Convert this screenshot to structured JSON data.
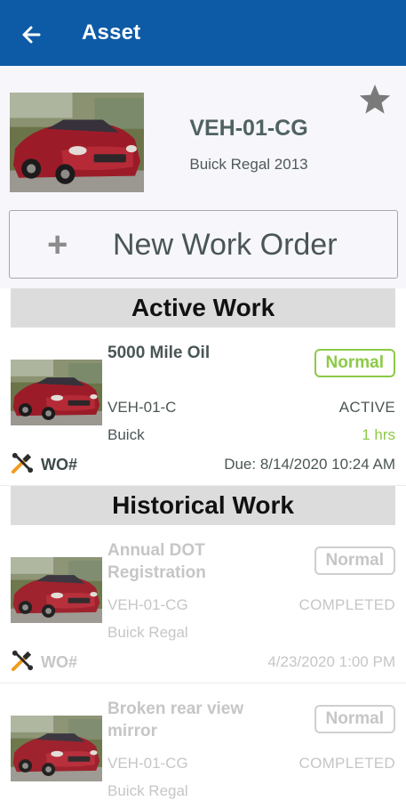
{
  "app_bar": {
    "title": "Asset",
    "back_icon": "arrow-left-icon",
    "background": "#0d5ba6"
  },
  "asset": {
    "id": "VEH-01-CG",
    "model": "Buick Regal 2013",
    "favorite_icon": "star-icon",
    "photo": "red-sedan-photo"
  },
  "new_work_order": {
    "plus": "+",
    "label": "New Work Order"
  },
  "sections": {
    "active_title": "Active Work",
    "historical_title": "Historical Work"
  },
  "active_work": [
    {
      "title": "5000 Mile Oil",
      "priority": "Normal",
      "asset": "VEH-01-C",
      "status": "ACTIVE",
      "model": "Buick",
      "hours": "1 hrs",
      "wo_label": "WO#",
      "date": "Due: 8/14/2020 10:24 AM"
    }
  ],
  "historical_work": [
    {
      "title": "Annual DOT Registration",
      "priority": "Normal",
      "asset": "VEH-01-CG",
      "status": "COMPLETED",
      "model": "Buick Regal",
      "wo_label": "WO#",
      "date": "4/23/2020 1:00 PM"
    },
    {
      "title": "Broken rear view mirror",
      "priority": "Normal",
      "asset": "VEH-01-CG",
      "status": "COMPLETED",
      "model": "Buick Regal"
    }
  ],
  "colors": {
    "priority_normal": "#8cca45",
    "completed_text": "#c6c6c6"
  }
}
